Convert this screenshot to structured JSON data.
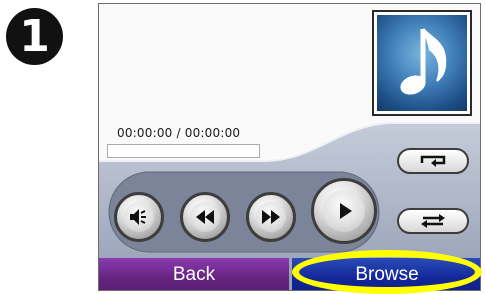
{
  "step_number": "1",
  "player": {
    "time_display": "00:00:00 / 00:00:00",
    "progress_fraction": 0,
    "album_art_icon": "music-note-icon"
  },
  "controls": {
    "volume_icon": "speaker-icon",
    "rewind_icon": "rewind-icon",
    "fast_forward_icon": "fast-forward-icon",
    "play_icon": "play-icon",
    "repeat_icon": "repeat-icon",
    "shuffle_icon": "shuffle-icon"
  },
  "buttons": {
    "back_label": "Back",
    "browse_label": "Browse"
  },
  "colors": {
    "back_button": "#66237f",
    "browse_button": "#13279a",
    "highlight": "#ffff00",
    "panel": "#a9b2c6"
  }
}
